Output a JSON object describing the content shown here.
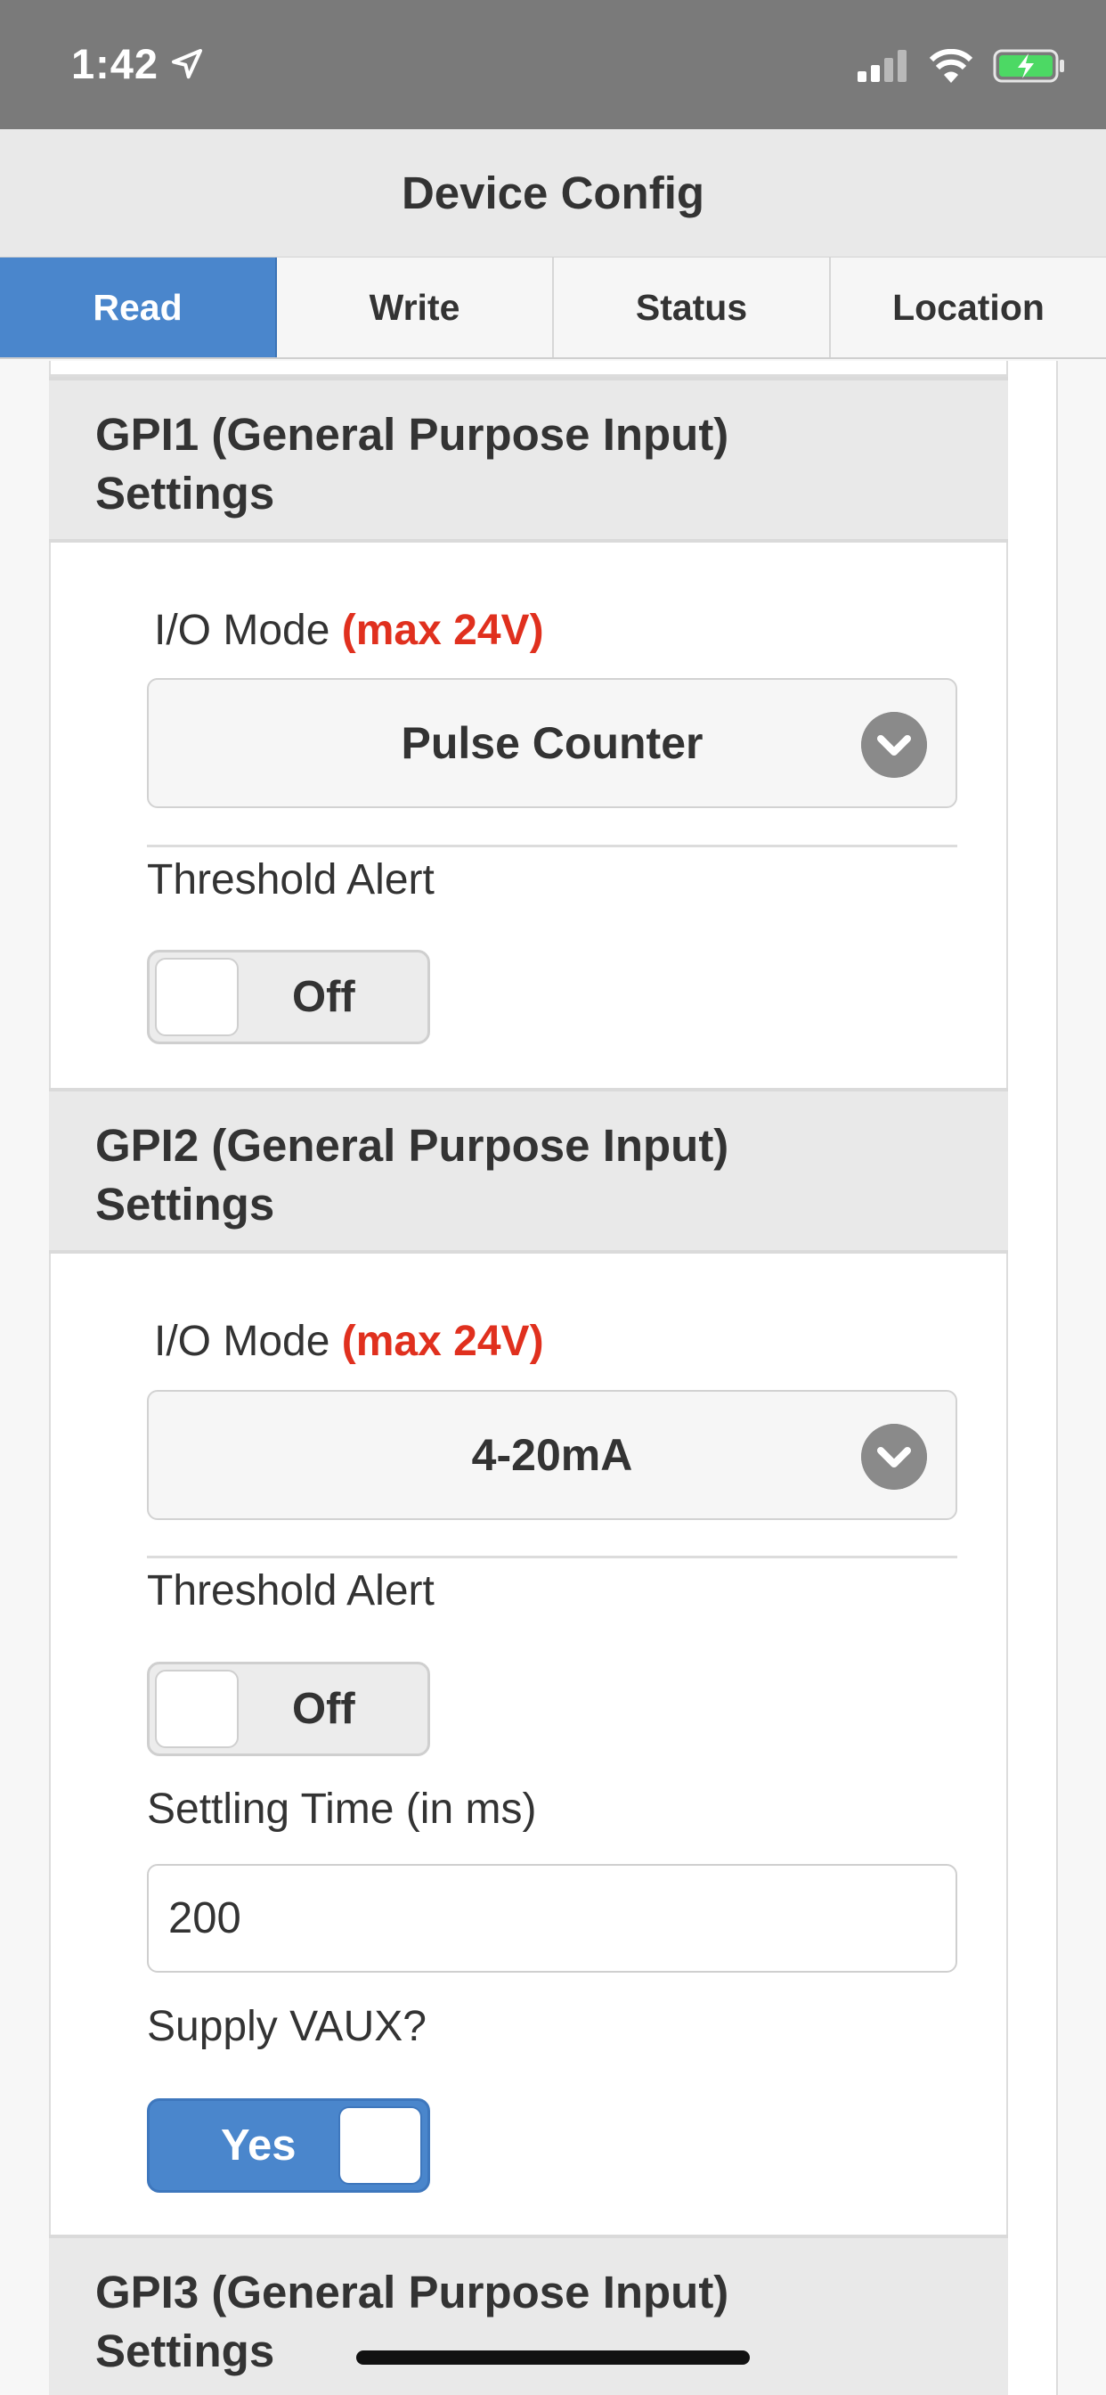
{
  "status_bar": {
    "time": "1:42",
    "icons": [
      "location-arrow-icon",
      "cellular-signal-icon",
      "wifi-icon",
      "battery-charging-icon"
    ],
    "battery_color": "#4cd964"
  },
  "header": {
    "title": "Device Config"
  },
  "tabs": [
    {
      "label": "Read",
      "active": true
    },
    {
      "label": "Write",
      "active": false
    },
    {
      "label": "Status",
      "active": false
    },
    {
      "label": "Location",
      "active": false
    }
  ],
  "colors": {
    "accent": "#4a86cc",
    "warning": "#e0301e"
  },
  "gpi1": {
    "title_line1": "GPI1 (General Purpose Input)",
    "title_line2": "Settings",
    "io_mode_label": "I/O Mode",
    "io_mode_warning": "(max 24V)",
    "io_mode_value": "Pulse Counter",
    "threshold_label": "Threshold Alert",
    "threshold_value": "Off"
  },
  "gpi2": {
    "title_line1": "GPI2 (General Purpose Input)",
    "title_line2": "Settings",
    "io_mode_label": "I/O Mode",
    "io_mode_warning": "(max 24V)",
    "io_mode_value": "4-20mA",
    "threshold_label": "Threshold Alert",
    "threshold_value": "Off",
    "settling_label": "Settling Time (in ms)",
    "settling_value": "200",
    "vaux_label": "Supply VAUX?",
    "vaux_value": "Yes"
  },
  "gpi3": {
    "title_line1": "GPI3 (General Purpose Input)",
    "title_line2": "Settings"
  }
}
